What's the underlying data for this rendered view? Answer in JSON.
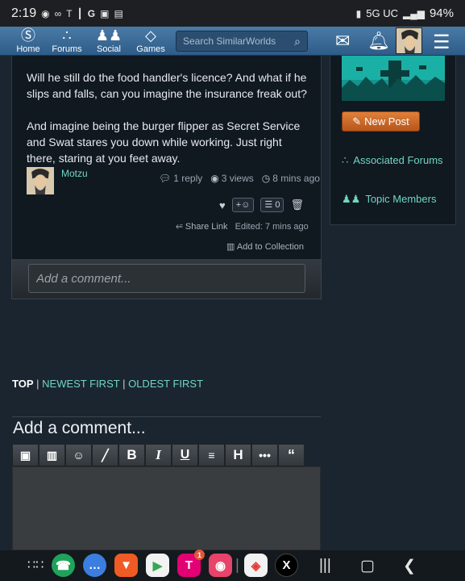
{
  "statusbar": {
    "time": "2:19",
    "left_icons": [
      "location-icon",
      "voicemail-icon",
      "t-mobile-icon",
      "vibrate-icon",
      "google-icon",
      "image-icon",
      "calendar-icon"
    ],
    "network": "5G UC",
    "battery": "94%"
  },
  "nav": {
    "home": "Home",
    "forums": "Forums",
    "social": "Social",
    "games": "Games",
    "search_placeholder": "Search SimilarWorlds"
  },
  "post": {
    "paragraph1": "Will he still do the food handler's licence? And what if he slips and falls, can you imagine the insurance freak out?",
    "paragraph2": "And imagine being the burger flipper as Secret Service and Swat stares you down while working. Just right there, staring at you feet away.",
    "author": "Motzu",
    "replies": "1 reply",
    "views": "3 views",
    "time": "8 mins ago",
    "reaction_add": "+☺",
    "list_count": "0",
    "share_label": "Share Link",
    "edited": "Edited: 7 mins ago",
    "collection_label": "Add to Collection",
    "comment_placeholder": "Add a comment..."
  },
  "sidebar": {
    "new_post": "New Post",
    "associated_forums": "Associated Forums",
    "topic_members": "Topic Members"
  },
  "sort": {
    "top": "TOP",
    "sep": "|",
    "newest": "NEWEST FIRST",
    "oldest": "OLDEST FIRST"
  },
  "composer": {
    "heading": "Add a comment...",
    "tools": [
      "image-icon",
      "video-icon",
      "emoji-icon",
      "brush-icon",
      "bold-icon",
      "italic-icon",
      "underline-icon",
      "strikethrough-icon",
      "heading-icon",
      "more-icon",
      "quote-icon"
    ]
  },
  "dock": {
    "tmobile_badge": "1"
  }
}
